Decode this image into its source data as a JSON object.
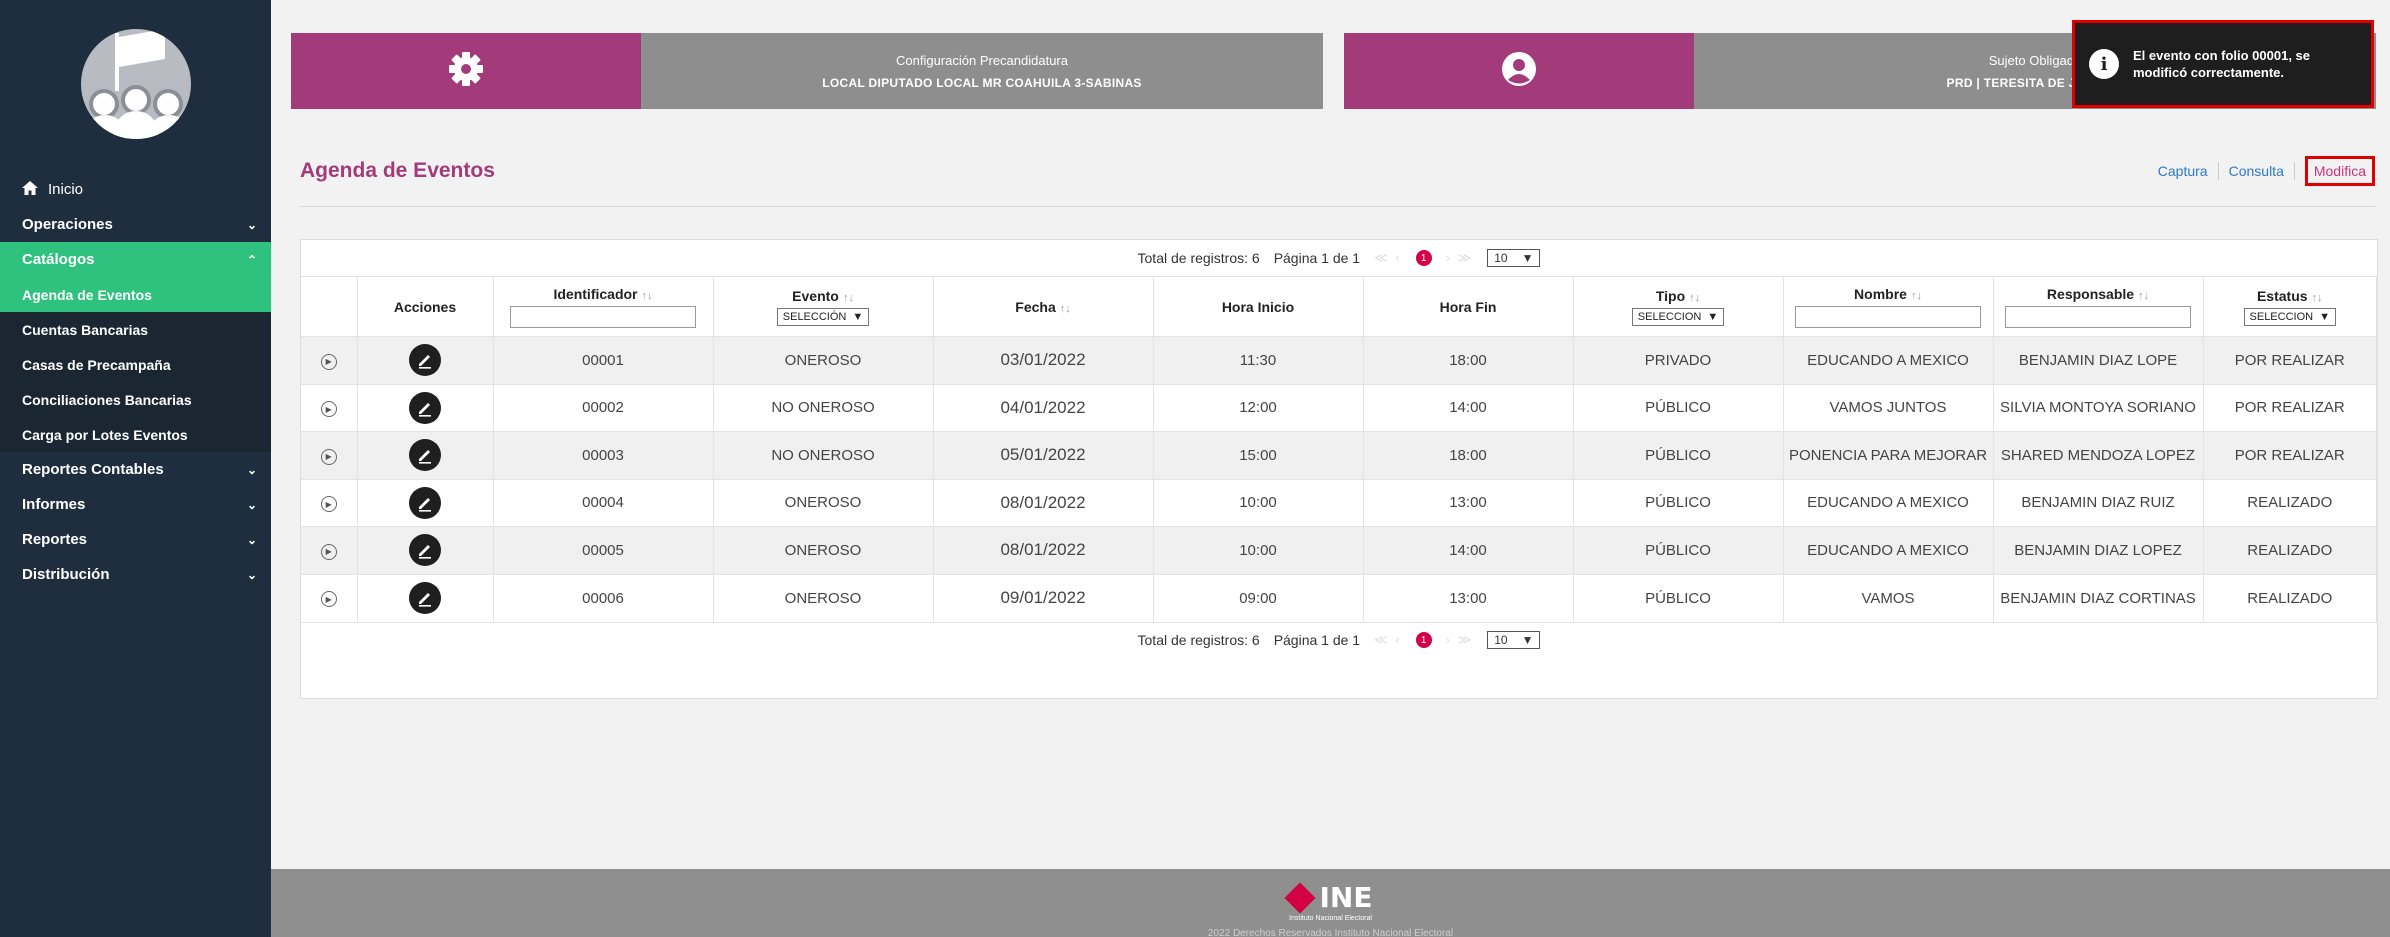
{
  "sidebar": {
    "home_label": "Inicio",
    "items": [
      {
        "label": "Operaciones"
      },
      {
        "label": "Catálogos"
      },
      {
        "label": "Reportes Contables"
      },
      {
        "label": "Informes"
      },
      {
        "label": "Reportes"
      },
      {
        "label": "Distribución"
      }
    ],
    "catalogos_sub": [
      "Agenda de Eventos",
      "Cuentas Bancarias",
      "Casas de Precampaña",
      "Conciliaciones Bancarias",
      "Carga por Lotes Eventos"
    ]
  },
  "header": {
    "config_title": "Configuración Precandidatura",
    "config_value": "LOCAL DIPUTADO LOCAL MR COAHUILA 3-SABINAS",
    "subject_title": "Sujeto Obligado",
    "subject_value": "PRD | TERESITA DE JESUS M"
  },
  "toast": {
    "message": "El evento con folio 00001, se modificó correctamente."
  },
  "page": {
    "title": "Agenda de Eventos",
    "tabs": [
      "Captura",
      "Consulta",
      "Modifica"
    ]
  },
  "pager": {
    "total": "Total de registros: 6",
    "page": "Página 1 de 1",
    "current": "1",
    "page_size": "10"
  },
  "table": {
    "headers": {
      "acciones": "Acciones",
      "identificador": "Identificador",
      "evento": "Evento",
      "fecha": "Fecha",
      "hora_inicio": "Hora Inicio",
      "hora_fin": "Hora Fin",
      "tipo": "Tipo",
      "nombre": "Nombre",
      "responsable": "Responsable",
      "estatus": "Estatus"
    },
    "filters": {
      "evento": "SELECCIÓN",
      "tipo": "SELECCION",
      "estatus": "SELECCION"
    },
    "rows": [
      {
        "id": "00001",
        "evento": "ONEROSO",
        "fecha": "03/01/2022",
        "inicio": "11:30",
        "fin": "18:00",
        "tipo": "PRIVADO",
        "nombre": "EDUCANDO A MEXICO",
        "responsable": "BENJAMIN DIAZ LOPE",
        "estatus": "POR REALIZAR"
      },
      {
        "id": "00002",
        "evento": "NO ONEROSO",
        "fecha": "04/01/2022",
        "inicio": "12:00",
        "fin": "14:00",
        "tipo": "PÚBLICO",
        "nombre": "VAMOS JUNTOS",
        "responsable": "SILVIA MONTOYA SORIANO",
        "estatus": "POR REALIZAR"
      },
      {
        "id": "00003",
        "evento": "NO ONEROSO",
        "fecha": "05/01/2022",
        "inicio": "15:00",
        "fin": "18:00",
        "tipo": "PÚBLICO",
        "nombre": "PONENCIA PARA MEJORAR",
        "responsable": "SHARED MENDOZA LOPEZ",
        "estatus": "POR REALIZAR"
      },
      {
        "id": "00004",
        "evento": "ONEROSO",
        "fecha": "08/01/2022",
        "inicio": "10:00",
        "fin": "13:00",
        "tipo": "PÚBLICO",
        "nombre": "EDUCANDO A MEXICO",
        "responsable": "BENJAMIN DIAZ RUIZ",
        "estatus": "REALIZADO"
      },
      {
        "id": "00005",
        "evento": "ONEROSO",
        "fecha": "08/01/2022",
        "inicio": "10:00",
        "fin": "14:00",
        "tipo": "PÚBLICO",
        "nombre": "EDUCANDO A MEXICO",
        "responsable": "BENJAMIN DIAZ LOPEZ",
        "estatus": "REALIZADO"
      },
      {
        "id": "00006",
        "evento": "ONEROSO",
        "fecha": "09/01/2022",
        "inicio": "09:00",
        "fin": "13:00",
        "tipo": "PÚBLICO",
        "nombre": "VAMOS",
        "responsable": "BENJAMIN DIAZ CORTINAS",
        "estatus": "REALIZADO"
      }
    ]
  },
  "footer": {
    "logo_text": "INE",
    "logo_sub": "Instituto Nacional Electoral",
    "text": "2022 Derechos Reservados Instituto Nacional Electoral"
  }
}
